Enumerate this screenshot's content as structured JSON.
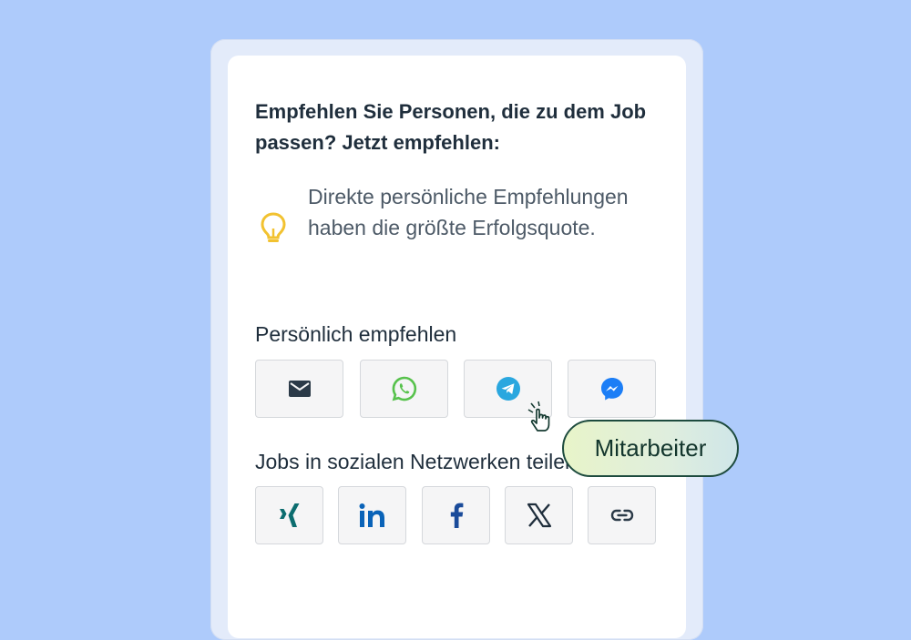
{
  "heading": "Empfehlen Sie Personen, die zu dem Job passen? Jetzt empfehlen:",
  "tip": {
    "icon": "lightbulb-icon",
    "text": "Direkte persönliche Empfehlungen haben die größte Erfolgsquote."
  },
  "personal": {
    "label": "Persönlich empfehlen",
    "buttons": [
      "email-icon",
      "whatsapp-icon",
      "telegram-icon",
      "messenger-icon"
    ]
  },
  "social": {
    "label": "Jobs in sozialen Netzwerken teilen",
    "buttons": [
      "xing-icon",
      "linkedin-icon",
      "facebook-icon",
      "x-icon",
      "link-icon"
    ]
  },
  "tooltip": "Mitarbeiter",
  "colors": {
    "background": "#aecbfb",
    "lightbulb": "#f2c230",
    "whatsapp": "#57c24c",
    "telegram": "#2aa7df",
    "messenger": "#1c7ef6",
    "xing": "#0c6d6f",
    "linkedin": "#0a63b8",
    "facebook": "#1a4b9a"
  }
}
